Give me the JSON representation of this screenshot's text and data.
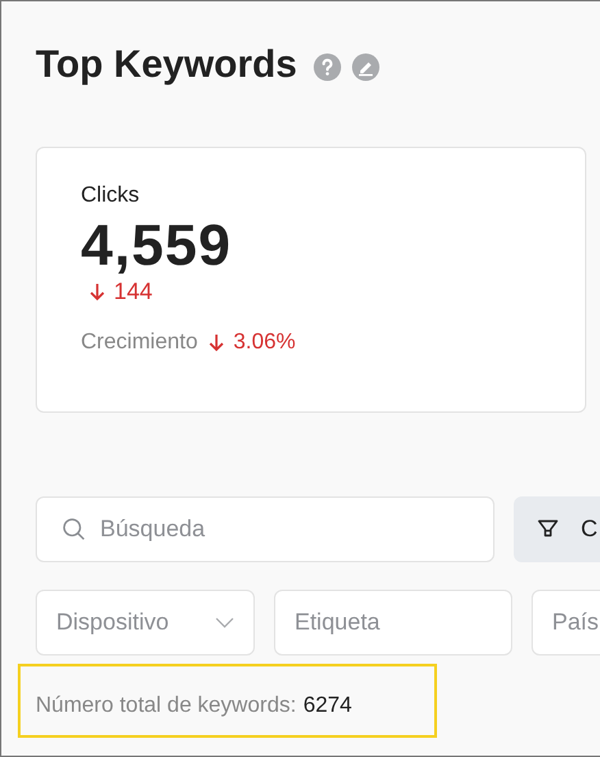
{
  "title": "Top Keywords",
  "metric": {
    "label": "Clicks",
    "value": "4,559",
    "change": "144",
    "growth_label": "Crecimiento",
    "growth_value": "3.06%"
  },
  "search": {
    "placeholder": "Búsqueda"
  },
  "columns_button": {
    "label": "C"
  },
  "filters": [
    {
      "kind": "select",
      "placeholder": "Dispositivo"
    },
    {
      "kind": "input",
      "placeholder": "Etiqueta"
    },
    {
      "kind": "input",
      "placeholder": "País"
    }
  ],
  "total": {
    "label": "Número total de keywords:",
    "value": "6274"
  }
}
